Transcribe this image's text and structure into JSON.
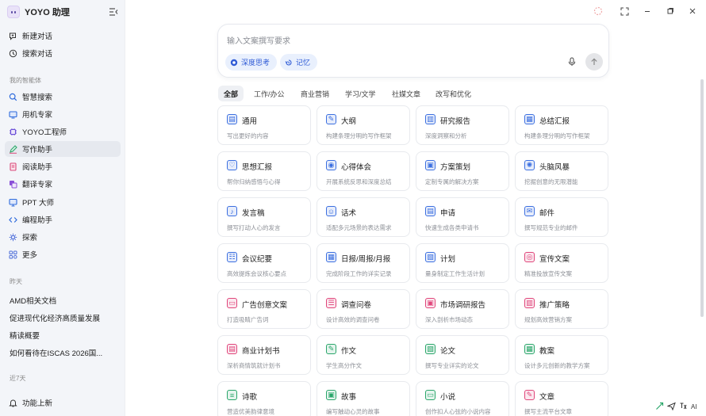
{
  "app": {
    "title": "YOYO 助理"
  },
  "sidebar": {
    "top": [
      {
        "label": "新建对话",
        "icon": "chat-plus-icon"
      },
      {
        "label": "搜索对话",
        "icon": "clock-search-icon"
      }
    ],
    "agents_label": "我的智能体",
    "agents": [
      {
        "label": "智慧搜索",
        "icon": "search-icon",
        "color": "#2f6bdc"
      },
      {
        "label": "用机专家",
        "icon": "device-icon",
        "color": "#2f6bdc"
      },
      {
        "label": "YOYO工程师",
        "icon": "chip-icon",
        "color": "#6b4fd8"
      },
      {
        "label": "写作助手",
        "icon": "pen-icon",
        "color": "#2aa66a"
      },
      {
        "label": "阅读助手",
        "icon": "book-icon",
        "color": "#d94a7a"
      },
      {
        "label": "翻译专家",
        "icon": "translate-icon",
        "color": "#8a4fd8"
      },
      {
        "label": "PPT 大师",
        "icon": "slides-icon",
        "color": "#2f6bdc"
      },
      {
        "label": "编程助手",
        "icon": "code-icon",
        "color": "#2f6bdc"
      },
      {
        "label": "探索",
        "icon": "gear-icon",
        "color": "#4a6bd8"
      },
      {
        "label": "更多",
        "icon": "grid-icon",
        "color": "#4a6bd8"
      }
    ],
    "yesterday_label": "昨天",
    "yesterday": [
      "AMD相关文档",
      "促进现代化经济高质量发展",
      "精读概要",
      "如何看待在ISCAS 2026国..."
    ],
    "week_label": "近7天",
    "bottom": {
      "label": "功能上新",
      "icon": "bell-icon"
    }
  },
  "composer": {
    "placeholder": "输入文案撰写要求",
    "deep_think": "深度思考",
    "memory": "记忆"
  },
  "tabs": [
    "全部",
    "工作/办公",
    "商业营销",
    "学习/文学",
    "社媒文章",
    "改写和优化"
  ],
  "cards": [
    {
      "title": "通用",
      "desc": "写出更好的内容",
      "icon": "doc-icon",
      "color": "#3b6fe0"
    },
    {
      "title": "大纲",
      "desc": "构建条理分明的写作框架",
      "icon": "outline-icon",
      "color": "#3b6fe0"
    },
    {
      "title": "研究报告",
      "desc": "深度洞察和分析",
      "icon": "report-icon",
      "color": "#3b6fe0"
    },
    {
      "title": "总结汇报",
      "desc": "构建条理分明的写作框架",
      "icon": "summary-icon",
      "color": "#3b6fe0"
    },
    {
      "title": "思想汇报",
      "desc": "帮你归纳感悟与心得",
      "icon": "thought-icon",
      "color": "#3b6fe0"
    },
    {
      "title": "心得体会",
      "desc": "开展系统反思和深度总结",
      "icon": "insight-icon",
      "color": "#3b6fe0"
    },
    {
      "title": "方案策划",
      "desc": "定制专属的解决方案",
      "icon": "plan-icon",
      "color": "#3b6fe0"
    },
    {
      "title": "头脑风暴",
      "desc": "挖掘创意的无限潜能",
      "icon": "brain-icon",
      "color": "#3b6fe0"
    },
    {
      "title": "发言稿",
      "desc": "撰写打动人心的发言",
      "icon": "mic-icon",
      "color": "#3b6fe0"
    },
    {
      "title": "话术",
      "desc": "适配多元场景的表达需求",
      "icon": "speech-icon",
      "color": "#3b6fe0"
    },
    {
      "title": "申请",
      "desc": "快速生成各类申请书",
      "icon": "apply-icon",
      "color": "#3b6fe0"
    },
    {
      "title": "邮件",
      "desc": "撰写规范专业的邮件",
      "icon": "mail-icon",
      "color": "#3b6fe0"
    },
    {
      "title": "会议纪要",
      "desc": "高效提炼会议核心要点",
      "icon": "meeting-icon",
      "color": "#3b6fe0"
    },
    {
      "title": "日报/周报/月报",
      "desc": "完成阶段工作的详实记录",
      "icon": "calendar-icon",
      "color": "#3b6fe0"
    },
    {
      "title": "计划",
      "desc": "量身制定工作生活计划",
      "icon": "clipboard-icon",
      "color": "#3b6fe0"
    },
    {
      "title": "宣传文案",
      "desc": "精准投放宣传文案",
      "icon": "promo-icon",
      "color": "#e0457a"
    },
    {
      "title": "广告创意文案",
      "desc": "打造吸睛广告词",
      "icon": "ad-icon",
      "color": "#e0457a"
    },
    {
      "title": "调查问卷",
      "desc": "设计高效的调查问卷",
      "icon": "survey-icon",
      "color": "#e0457a"
    },
    {
      "title": "市场调研报告",
      "desc": "深入剖析市场动态",
      "icon": "market-icon",
      "color": "#e0457a"
    },
    {
      "title": "推广策略",
      "desc": "规划高效营销方案",
      "icon": "strategy-icon",
      "color": "#e0457a"
    },
    {
      "title": "商业计划书",
      "desc": "深析商情筑就计划书",
      "icon": "bizplan-icon",
      "color": "#e0457a"
    },
    {
      "title": "作文",
      "desc": "学生高分作文",
      "icon": "essay-icon",
      "color": "#2aa66a"
    },
    {
      "title": "论文",
      "desc": "撰写专业详实的论文",
      "icon": "paper-icon",
      "color": "#2aa66a"
    },
    {
      "title": "教案",
      "desc": "设计多元创新的教学方案",
      "icon": "lesson-icon",
      "color": "#2aa66a"
    },
    {
      "title": "诗歌",
      "desc": "营造优美韵律意境",
      "icon": "poem-icon",
      "color": "#2aa66a"
    },
    {
      "title": "故事",
      "desc": "编写触动心灵的故事",
      "icon": "story-icon",
      "color": "#2aa66a"
    },
    {
      "title": "小说",
      "desc": "创作扣人心弦的小说内容",
      "icon": "novel-icon",
      "color": "#2aa66a"
    },
    {
      "title": "文章",
      "desc": "撰写主流平台文章",
      "icon": "article-icon",
      "color": "#e0457a"
    }
  ],
  "tray": {
    "ai_label": "AI"
  }
}
